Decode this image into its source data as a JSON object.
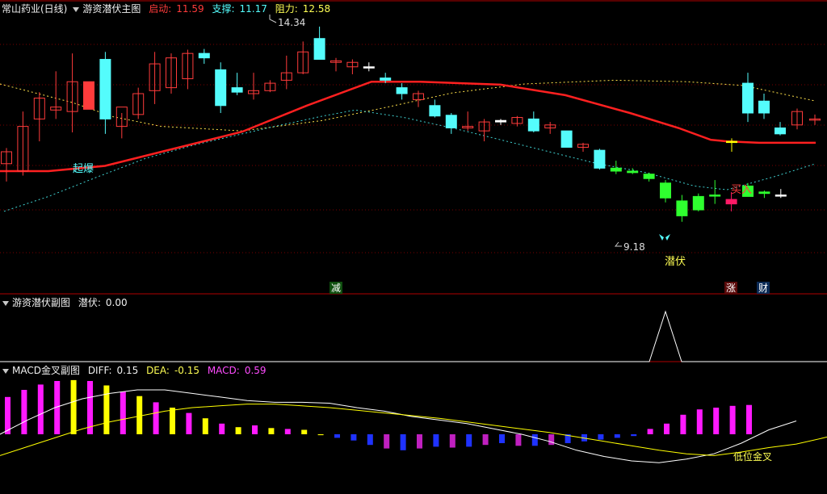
{
  "header_main": {
    "stock": "常山药业(日线)",
    "indicator": "游资潜伏主图",
    "qidong_label": "启动:",
    "qidong_value": "11.59",
    "zhicheng_label": "支撑:",
    "zhicheng_value": "11.17",
    "zuli_label": "阻力:",
    "zuli_value": "12.58"
  },
  "header_sub": {
    "title": "游资潜伏副图",
    "value_label": "潜伏:",
    "value": "0.00"
  },
  "header_macd": {
    "title": "MACD金叉副图",
    "diff_label": "DIFF:",
    "diff_value": "0.15",
    "dea_label": "DEA:",
    "dea_value": "-0.15",
    "macd_label": "MACD:",
    "macd_value": "0.59"
  },
  "colors": {
    "up": "#ff3b3b",
    "down": "#54fcfc",
    "cyan_fill": "#54fcfc",
    "green": "#2fff2f",
    "red_line": "#ff2020",
    "yellow_dot": "#ffe14a",
    "cyan_dot": "#3fd0d0",
    "macd_pos": "#ff1aff",
    "macd_pos_dark": "#c020c0",
    "macd_yellow": "#ffff00",
    "macd_neg": "#1f32ff",
    "grid": "#7a0000",
    "divider": "#b00000"
  },
  "chart_data": [
    {
      "type": "candlestick",
      "title": "游资潜伏主图",
      "annotations": {
        "high": "14.34",
        "low": "9.18",
        "qibao": "起爆",
        "qianfu": "潜伏",
        "mairu": "买入",
        "jian": "减",
        "zhang": "涨",
        "cai": "财"
      },
      "candles": [
        {
          "o": 12.5,
          "h": 12.71,
          "l": 12.26,
          "c": 12.66,
          "style": "up"
        },
        {
          "o": 12.4,
          "h": 13.2,
          "l": 12.34,
          "c": 13.0,
          "style": "up"
        },
        {
          "o": 13.1,
          "h": 13.46,
          "l": 12.8,
          "c": 13.38,
          "style": "up"
        },
        {
          "o": 13.22,
          "h": 13.74,
          "l": 13.1,
          "c": 13.26,
          "style": "up"
        },
        {
          "o": 13.2,
          "h": 13.98,
          "l": 12.92,
          "c": 13.6,
          "style": "up"
        },
        {
          "o": 13.6,
          "h": 13.6,
          "l": 13.26,
          "c": 13.23,
          "style": "red"
        },
        {
          "o": 13.9,
          "h": 14.0,
          "l": 12.9,
          "c": 13.1,
          "style": "cyan"
        },
        {
          "o": 13.0,
          "h": 13.18,
          "l": 12.84,
          "c": 13.26,
          "style": "up"
        },
        {
          "o": 13.16,
          "h": 13.52,
          "l": 13.1,
          "c": 13.44,
          "style": "up"
        },
        {
          "o": 13.48,
          "h": 14.0,
          "l": 13.3,
          "c": 13.84,
          "style": "up"
        },
        {
          "o": 13.52,
          "h": 13.98,
          "l": 13.44,
          "c": 13.92,
          "style": "up"
        },
        {
          "o": 13.64,
          "h": 14.03,
          "l": 13.5,
          "c": 13.98,
          "style": "up"
        },
        {
          "o": 13.98,
          "h": 14.04,
          "l": 13.84,
          "c": 13.92,
          "style": "cyan"
        },
        {
          "o": 13.76,
          "h": 13.86,
          "l": 13.18,
          "c": 13.28,
          "style": "cyan"
        },
        {
          "o": 13.52,
          "h": 13.72,
          "l": 13.42,
          "c": 13.46,
          "style": "cyan"
        },
        {
          "o": 13.48,
          "h": 13.72,
          "l": 13.36,
          "c": 13.44,
          "style": "up"
        },
        {
          "o": 13.48,
          "h": 13.62,
          "l": 13.46,
          "c": 13.58,
          "style": "up"
        },
        {
          "o": 13.62,
          "h": 13.95,
          "l": 13.5,
          "c": 13.72,
          "style": "up"
        },
        {
          "o": 13.72,
          "h": 14.14,
          "l": 13.7,
          "c": 14.0,
          "style": "up"
        },
        {
          "o": 14.18,
          "h": 14.34,
          "l": 13.9,
          "c": 13.9,
          "style": "cyan"
        },
        {
          "o": 13.86,
          "h": 13.92,
          "l": 13.74,
          "c": 13.88,
          "style": "up"
        },
        {
          "o": 13.8,
          "h": 13.9,
          "l": 13.7,
          "c": 13.86,
          "style": "up"
        },
        {
          "o": 13.8,
          "h": 13.86,
          "l": 13.74,
          "c": 13.8,
          "style": "white"
        },
        {
          "o": 13.65,
          "h": 13.72,
          "l": 13.58,
          "c": 13.62,
          "style": "cyan"
        },
        {
          "o": 13.52,
          "h": 13.58,
          "l": 13.36,
          "c": 13.44,
          "style": "cyan"
        },
        {
          "o": 13.36,
          "h": 13.48,
          "l": 13.26,
          "c": 13.44,
          "style": "up"
        },
        {
          "o": 13.28,
          "h": 13.36,
          "l": 13.12,
          "c": 13.14,
          "style": "cyan"
        },
        {
          "o": 13.15,
          "h": 13.18,
          "l": 12.9,
          "c": 12.98,
          "style": "cyan"
        },
        {
          "o": 12.98,
          "h": 13.2,
          "l": 12.94,
          "c": 13.0,
          "style": "up"
        },
        {
          "o": 12.94,
          "h": 13.1,
          "l": 12.8,
          "c": 13.06,
          "style": "up"
        },
        {
          "o": 13.08,
          "h": 13.1,
          "l": 13.02,
          "c": 13.06,
          "style": "white"
        },
        {
          "o": 13.04,
          "h": 13.14,
          "l": 13.0,
          "c": 13.12,
          "style": "up"
        },
        {
          "o": 13.1,
          "h": 13.2,
          "l": 12.92,
          "c": 12.94,
          "style": "cyan"
        },
        {
          "o": 12.98,
          "h": 13.06,
          "l": 12.9,
          "c": 13.02,
          "style": "up"
        },
        {
          "o": 12.94,
          "h": 12.94,
          "l": 12.72,
          "c": 12.72,
          "style": "cyan"
        },
        {
          "o": 12.72,
          "h": 12.78,
          "l": 12.66,
          "c": 12.76,
          "style": "up"
        },
        {
          "o": 12.68,
          "h": 12.7,
          "l": 12.42,
          "c": 12.44,
          "style": "cyan"
        },
        {
          "o": 12.44,
          "h": 12.54,
          "l": 12.36,
          "c": 12.4,
          "style": "green"
        },
        {
          "o": 12.4,
          "h": 12.44,
          "l": 12.36,
          "c": 12.38,
          "style": "green"
        },
        {
          "o": 12.36,
          "h": 12.38,
          "l": 12.26,
          "c": 12.3,
          "style": "green"
        },
        {
          "o": 12.24,
          "h": 12.28,
          "l": 11.98,
          "c": 12.04,
          "style": "green"
        },
        {
          "o": 12.0,
          "h": 12.08,
          "l": 11.72,
          "c": 11.8,
          "style": "green"
        },
        {
          "o": 11.88,
          "h": 12.1,
          "l": 11.86,
          "c": 12.06,
          "style": "green"
        },
        {
          "o": 12.08,
          "h": 12.28,
          "l": 11.96,
          "c": 12.08,
          "style": "green"
        },
        {
          "o": 12.02,
          "h": 12.12,
          "l": 11.86,
          "c": 11.96,
          "style": "pink"
        },
        {
          "o": 12.06,
          "h": 12.24,
          "l": 12.06,
          "c": 12.2,
          "style": "green"
        },
        {
          "o": 12.1,
          "h": 12.14,
          "l": 12.04,
          "c": 12.12,
          "style": "green"
        },
        {
          "o": 12.08,
          "h": 12.16,
          "l": 12.04,
          "c": 12.08,
          "style": "white"
        }
      ],
      "candles_right": [
        {
          "o": 12.8,
          "h": 12.84,
          "l": 12.66,
          "c": 12.8,
          "style": "yellow"
        },
        {
          "o": 13.18,
          "h": 13.72,
          "l": 13.06,
          "c": 13.58,
          "style": "cyan"
        },
        {
          "o": 13.34,
          "h": 13.44,
          "l": 13.1,
          "c": 13.18,
          "style": "cyan"
        },
        {
          "o": 12.98,
          "h": 13.06,
          "l": 12.88,
          "c": 12.9,
          "style": "cyan"
        },
        {
          "o": 13.02,
          "h": 13.24,
          "l": 12.96,
          "c": 13.2,
          "style": "up"
        },
        {
          "o": 13.1,
          "h": 13.16,
          "l": 13.02,
          "c": 13.1,
          "style": "up"
        }
      ]
    },
    {
      "type": "line",
      "title": "游资潜伏副图",
      "series": [
        {
          "name": "潜伏",
          "values": [
            0,
            0,
            1,
            0,
            0
          ]
        }
      ]
    },
    {
      "type": "bar",
      "title": "MACD金叉副图",
      "series": [
        {
          "name": "MACD",
          "values": [
            0.42,
            0.5,
            0.56,
            0.6,
            0.61,
            0.6,
            0.55,
            0.48,
            0.43,
            0.36,
            0.3,
            0.24,
            0.18,
            0.12,
            0.08,
            0.1,
            0.07,
            0.06,
            0.05,
            -0.01,
            -0.04,
            -0.07,
            -0.12,
            -0.16,
            -0.18,
            -0.16,
            -0.14,
            -0.15,
            -0.14,
            -0.12,
            -0.1,
            -0.13,
            -0.13,
            -0.12,
            -0.1,
            -0.08,
            -0.06,
            -0.04,
            -0.02,
            0.06,
            0.12,
            0.22,
            0.28,
            0.3,
            0.32,
            0.33
          ]
        },
        {
          "name": "DIFF",
          "values": [
            0.0,
            0.16,
            0.3,
            0.4,
            0.46,
            0.5,
            0.5,
            0.46,
            0.42,
            0.38,
            0.36,
            0.36,
            0.35,
            0.3,
            0.26,
            0.2,
            0.16,
            0.12,
            0.06,
            0.0,
            -0.08,
            -0.18,
            -0.25,
            -0.3,
            -0.32,
            -0.28,
            -0.22,
            -0.1,
            0.05,
            0.15
          ]
        },
        {
          "name": "DEA",
          "values": [
            -0.24,
            -0.14,
            -0.04,
            0.06,
            0.14,
            0.2,
            0.26,
            0.3,
            0.32,
            0.34,
            0.34,
            0.32,
            0.3,
            0.27,
            0.24,
            0.21,
            0.18,
            0.14,
            0.1,
            0.06,
            0.02,
            -0.03,
            -0.08,
            -0.13,
            -0.18,
            -0.22,
            -0.24,
            -0.2,
            -0.15,
            -0.11,
            -0.04,
            0.04
          ]
        }
      ],
      "labels": {
        "golden_cross": "低位金叉"
      }
    }
  ]
}
